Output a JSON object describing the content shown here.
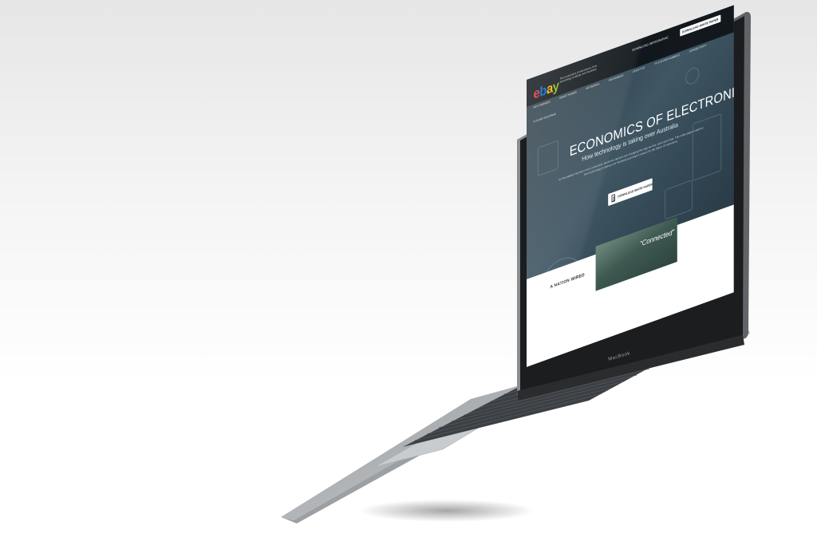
{
  "device": {
    "brand_label": "MacBook",
    "colors": {
      "bezel": "#1b1d1f",
      "lid_edge": "#6d7176",
      "deck_light": "#c9cbcd",
      "deck_dark": "#6a6e72",
      "keyboard": "#3b3e42"
    }
  },
  "website": {
    "logo": {
      "e": "e",
      "b": "b",
      "a": "a",
      "y": "y"
    },
    "logo_colors": {
      "e": "#e53238",
      "b": "#0064d2",
      "a": "#f5af02",
      "y": "#86b817"
    },
    "tagline": "The economics of electronics: how technology is taking over Australia",
    "top_buttons": {
      "infographic": "DOWNLOAD INFOGRAPHIC",
      "whitepaper": "DOWNLOAD WHITE PAPER"
    },
    "nav": [
      "KEY FINDINGS",
      "SMART HOMES",
      "NETWORKS",
      "WEARABLES",
      "LIFESTYLE",
      "TV & ENTERTAINMENT",
      "CONNECTIVITY",
      "FUTURE SHOPPING"
    ],
    "hero": {
      "title": "ECONOMICS OF ELECTRONICS",
      "subtitle": "How technology is taking over Australia",
      "body": "As Australians become more connected, electronic devices are changing the way we live, work and shop. This white paper explores how technology is taking over Australia and what it means for the future of commerce.",
      "button_label": "DOWNLOAD WHITE PAPER"
    },
    "band": {
      "heading": "A NATION WIRED",
      "photo_caption": "\"Connected\""
    }
  }
}
